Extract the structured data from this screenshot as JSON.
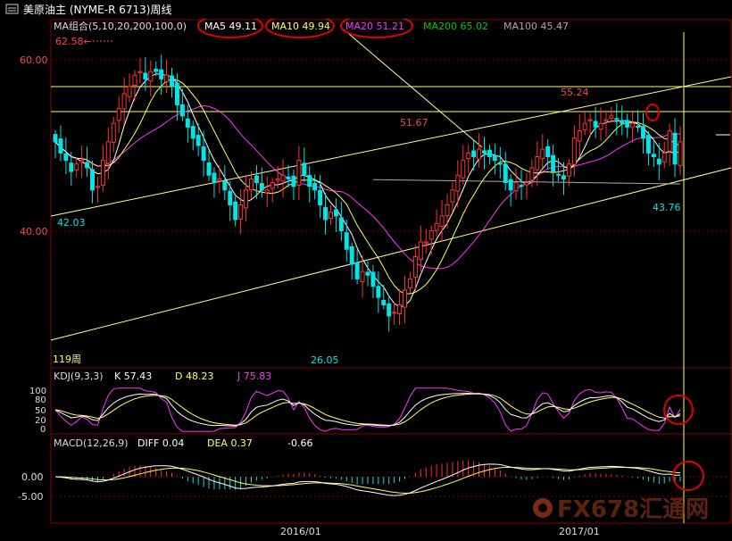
{
  "window": {
    "title": "美原油主 (NYME-R 6713)周线"
  },
  "price_legend": {
    "group_label": "MA组合(5,10,20,200,100,0)",
    "ma5": "MA5 49.11",
    "ma10": "MA10 49.94",
    "ma20": "MA20 51.21",
    "ma200": "MA200 65.02",
    "ma100": "MA100 45.47"
  },
  "annotations": {
    "high_left": "62.58←",
    "low_left": "42.03",
    "low_mid": "26.05",
    "high_mid": "51.67",
    "high_right": "55.24",
    "low_right": "43.76",
    "bar_count": "119周"
  },
  "price_axis": {
    "ticks": [
      "60.00",
      "40.00"
    ]
  },
  "kdj_legend": {
    "name": "KDJ(9,3,3)",
    "k": "K  57.43",
    "d": "D  48.23",
    "j": "J  75.83"
  },
  "kdj_axis": {
    "ticks": [
      "100",
      "80",
      "50",
      "20",
      "0"
    ]
  },
  "macd_legend": {
    "name": "MACD(12,26,9)",
    "diff": "DIFF  0.04",
    "dea": "DEA  0.37",
    "macd": "-0.66"
  },
  "macd_axis": {
    "ticks": [
      "0.00",
      "-5.00"
    ]
  },
  "time_axis": {
    "labels": [
      "2016/01",
      "2017/01"
    ]
  },
  "watermark": {
    "text": "FX678汇通网"
  },
  "colors": {
    "up": "#ff3232",
    "down": "#00e5e5",
    "ma5": "#ffffff",
    "ma10": "#ffff66",
    "ma20": "#ff33ff",
    "ma200": "#00cc00",
    "ma100": "#aaaaaa",
    "trend": "#ffff99",
    "circle": "#e00000"
  },
  "chart_data": {
    "type": "candlestick",
    "frequency": "weekly",
    "bars": 119,
    "ylim": [
      20,
      67
    ],
    "closes": [
      50.5,
      49.0,
      48.0,
      46.5,
      47.5,
      48.0,
      47.0,
      44.0,
      44.5,
      48.0,
      50.5,
      53.0,
      55.0,
      57.0,
      58.0,
      59.5,
      60.0,
      59.0,
      60.0,
      60.0,
      59.0,
      59.5,
      58.0,
      55.5,
      54.0,
      52.5,
      51.0,
      50.0,
      48.0,
      46.0,
      45.0,
      45.5,
      44.0,
      42.0,
      40.0,
      42.0,
      44.0,
      45.5,
      45.0,
      44.0,
      44.0,
      45.0,
      45.5,
      46.0,
      45.5,
      44.5,
      48.0,
      46.0,
      44.5,
      44.0,
      42.0,
      40.0,
      41.0,
      40.5,
      38.5,
      36.0,
      34.0,
      32.0,
      33.0,
      32.5,
      31.0,
      29.5,
      28.5,
      27.0,
      27.5,
      28.5,
      30.5,
      32.0,
      35.0,
      37.0,
      37.0,
      38.5,
      39.5,
      40.5,
      42.0,
      44.0,
      46.0,
      48.0,
      49.0,
      48.5,
      49.5,
      49.0,
      48.5,
      48.0,
      47.5,
      45.0,
      44.0,
      45.0,
      44.5,
      45.0,
      47.0,
      48.5,
      49.5,
      48.5,
      46.5,
      46.0,
      45.5,
      47.5,
      51.0,
      52.0,
      53.0,
      53.5,
      52.5,
      53.0,
      53.5,
      54.0,
      53.5,
      53.0,
      52.5,
      53.0,
      52.5,
      51.0,
      49.0,
      48.5,
      47.5,
      49.0,
      52.0,
      47.5,
      50.5
    ],
    "ma_lines": [
      "MA5",
      "MA10",
      "MA20",
      "MA200",
      "MA100"
    ],
    "kdj": {
      "k": 57.43,
      "d": 48.23,
      "j": 75.83
    },
    "macd": {
      "diff": 0.04,
      "dea": 0.37,
      "macd": -0.66
    }
  }
}
